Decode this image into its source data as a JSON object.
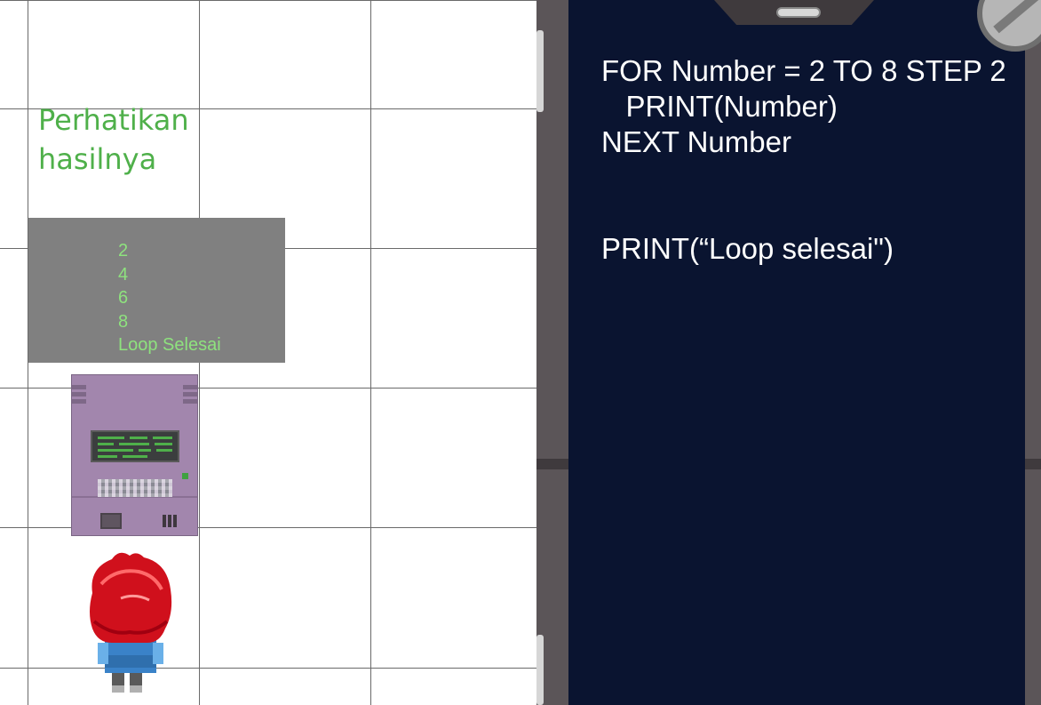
{
  "game": {
    "hint_text": "Perhatikan\nhasilnya",
    "console": {
      "lines": [
        "2",
        "4",
        "6",
        "8",
        "Loop Selesai"
      ]
    },
    "colors": {
      "hint": "#4fb04a",
      "console_bg": "#808080",
      "console_text": "#8ee27e",
      "grid_line": "#6a6a6a"
    }
  },
  "code_panel": {
    "lines": [
      "FOR Number = 2 TO 8 STEP 2",
      "   PRINT(Number)",
      "NEXT Number",
      "",
      "",
      "PRINT(“Loop selesai\")"
    ],
    "colors": {
      "background": "#0a1430",
      "text": "#ffffff",
      "frame": "#5b5558"
    }
  }
}
